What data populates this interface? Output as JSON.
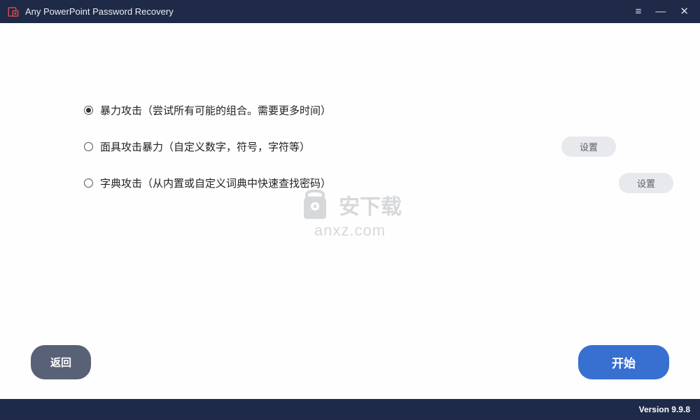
{
  "title": "Any PowerPoint Password Recovery",
  "options": [
    {
      "label": "暴力攻击（尝试所有可能的组合。需要更多时间）",
      "selected": true,
      "has_settings": false
    },
    {
      "label": "面具攻击暴力（自定义数字，符号，字符等）",
      "selected": false,
      "has_settings": true
    },
    {
      "label": "字典攻击（从内置或自定义词典中快速查找密码）",
      "selected": false,
      "has_settings": true
    }
  ],
  "settings_label": "设置",
  "back_label": "返回",
  "start_label": "开始",
  "version": "Version 9.9.8",
  "watermark": {
    "line1": "安下载",
    "line2": "anxz.com"
  }
}
